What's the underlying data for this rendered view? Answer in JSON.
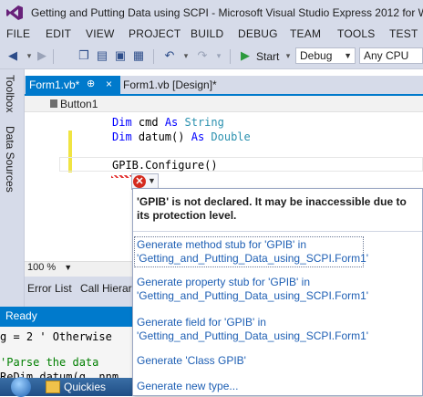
{
  "window": {
    "title": "Getting and Putting Data using SCPI - Microsoft Visual Studio Express 2012 for W"
  },
  "menu": [
    "FILE",
    "EDIT",
    "VIEW",
    "PROJECT",
    "BUILD",
    "DEBUG",
    "TEAM",
    "TOOLS",
    "TEST"
  ],
  "toolbar": {
    "start_label": "Start",
    "config_value": "Debug",
    "platform_value": "Any CPU"
  },
  "side_panel": {
    "toolbox_label": "Toolbox",
    "datasources_label": "Data Sources"
  },
  "tabs": {
    "active_label": "Form1.vb*",
    "pin_glyph": "⊕",
    "close_glyph": "×",
    "design_label": "Form1.vb [Design]*"
  },
  "nav": {
    "member": "Button1"
  },
  "code": {
    "line1_kw1": "Dim",
    "line1_rest": " cmd ",
    "line1_kw2": "As",
    "line1_type": " String",
    "line2_kw1": "Dim",
    "line2_rest": " datum() ",
    "line2_kw2": "As",
    "line2_type": " Double",
    "line3": "GPIB.Configure()"
  },
  "zoom": {
    "value": "100 %"
  },
  "bottom_tabs": [
    "Error List",
    "Call Hierarc"
  ],
  "status": {
    "text": "Ready"
  },
  "background_code": {
    "line1": "g = 2 ' Otherwise",
    "line2": "'Parse the data",
    "line3": "ReDim datum(g  nnm"
  },
  "taskbar": {
    "label": "Quickies"
  },
  "popup": {
    "message": "'GPIB' is not declared. It may be inaccessible due to its protection level.",
    "fixes": [
      "Generate method stub for 'GPIB' in 'Getting_and_Putting_Data_using_SCPI.Form1'",
      "Generate property stub for 'GPIB' in 'Getting_and_Putting_Data_using_SCPI.Form1'",
      "Generate field for 'GPIB' in 'Getting_and_Putting_Data_using_SCPI.Form1'",
      "Generate 'Class GPIB'",
      "Generate new type..."
    ]
  },
  "colors": {
    "accent": "#007acc",
    "chrome": "#d6dbe9",
    "link": "#1e5fb4",
    "error": "#d52b1e"
  },
  "icons": [
    "vs-logo-icon",
    "back-icon",
    "forward-icon",
    "new-project-icon",
    "open-icon",
    "save-icon",
    "save-all-icon",
    "undo-icon",
    "redo-icon",
    "start-icon",
    "error-icon"
  ]
}
